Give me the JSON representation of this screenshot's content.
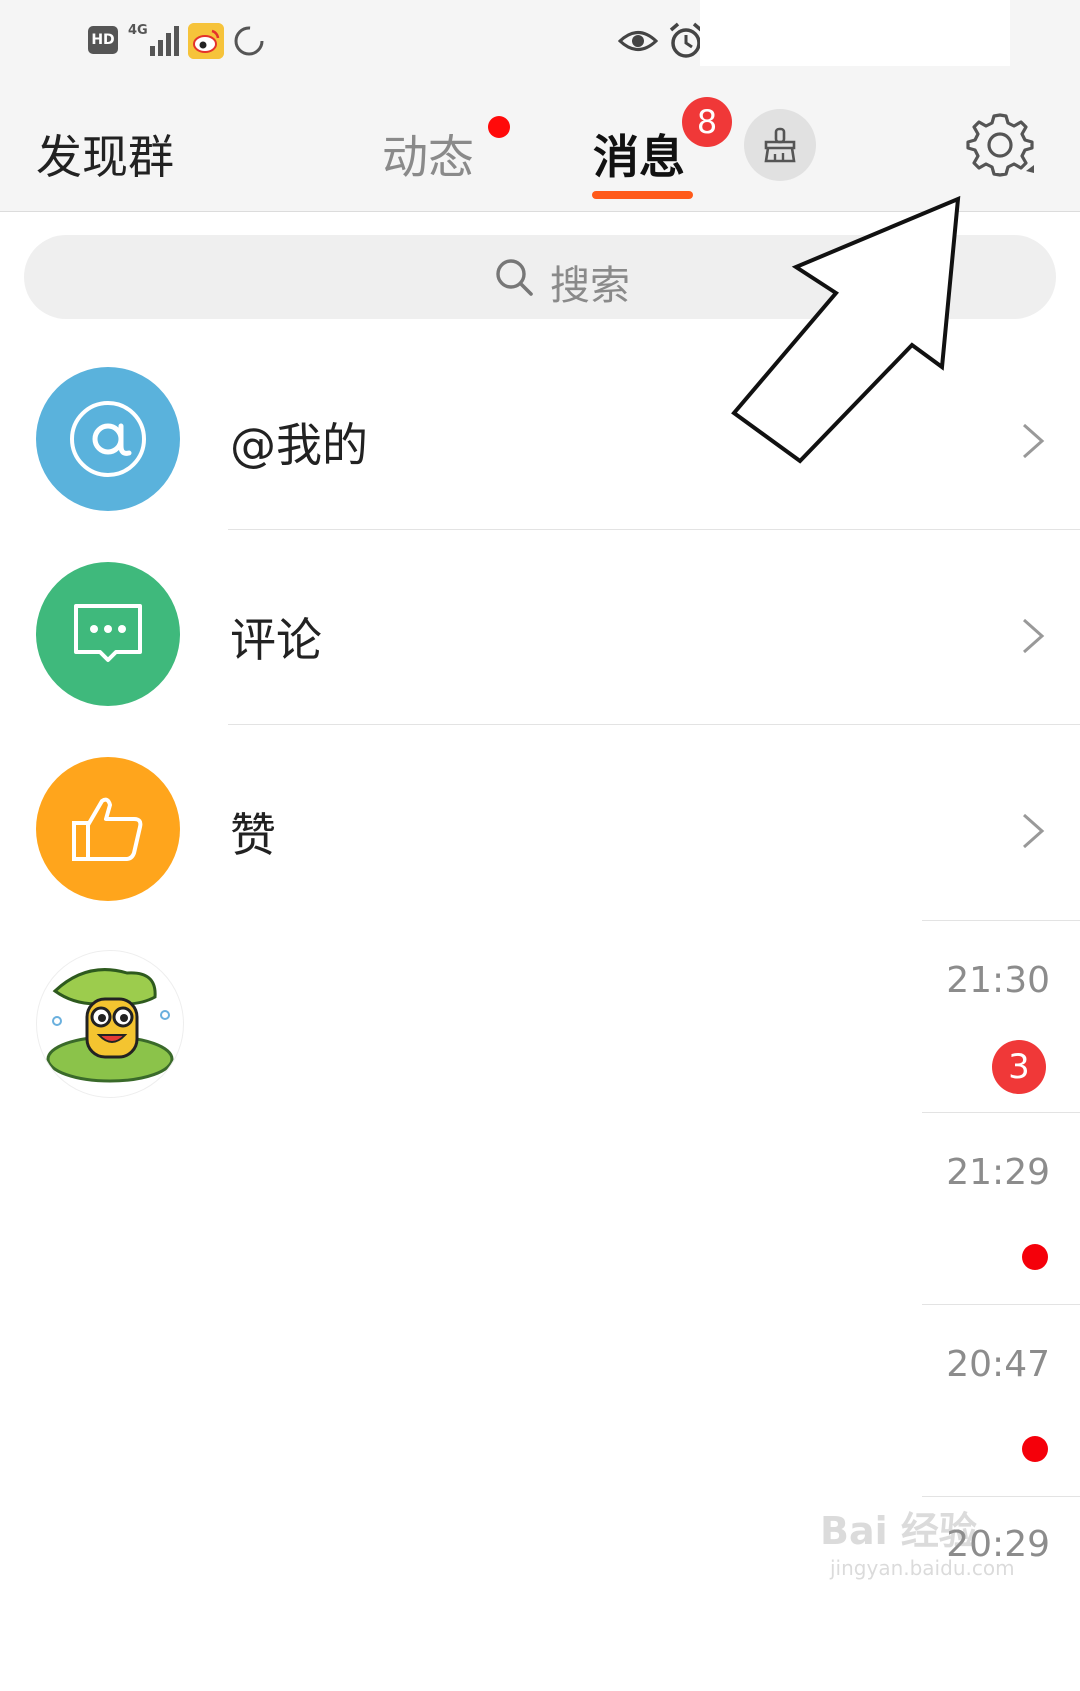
{
  "status_bar": {
    "hd_label": "HD",
    "network_label": "4G",
    "icons": [
      "hd-icon",
      "signal-icon",
      "weibo-app-icon",
      "loading-icon",
      "eye-icon",
      "alarm-icon"
    ]
  },
  "header": {
    "title": "发现群",
    "tabs": [
      {
        "label": "动态",
        "has_dot": true
      },
      {
        "label": "消息",
        "active": true,
        "badge": "8"
      }
    ],
    "clean_icon": "broom-icon",
    "settings_icon": "gear-icon"
  },
  "search": {
    "placeholder": "搜索"
  },
  "menu_rows": [
    {
      "label": "@我的",
      "icon": "at-icon",
      "color": "#5ab2dc"
    },
    {
      "label": "评论",
      "icon": "comment-icon",
      "color": "#3fb97c"
    },
    {
      "label": "赞",
      "icon": "thumbs-up-icon",
      "color": "#ffa51c"
    }
  ],
  "chats": [
    {
      "time": "21:30",
      "badge": "3"
    },
    {
      "time": "21:29",
      "unread_dot": true
    },
    {
      "time": "20:47",
      "unread_dot": true
    },
    {
      "time": "20:29"
    }
  ],
  "watermark": {
    "text": "Bai 经验",
    "sub": "jingyan.baidu.com"
  },
  "colors": {
    "accent": "#ff5a1a",
    "badge_red": "#f03838"
  }
}
